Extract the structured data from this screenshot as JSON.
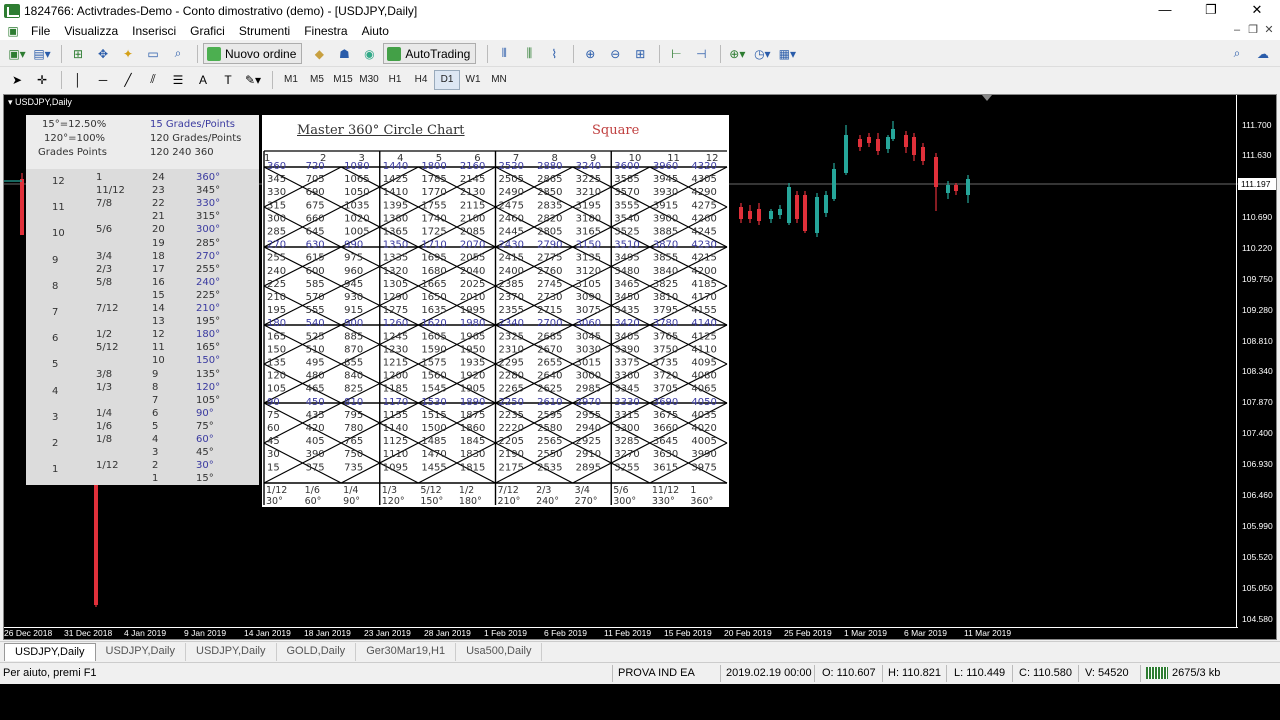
{
  "window": {
    "title": "1824766: Activtrades-Demo - Conto dimostrativo (demo) - [USDJPY,Daily]",
    "minimize": "—",
    "maximize": "❐",
    "close": "✕"
  },
  "menu": [
    "File",
    "Visualizza",
    "Inserisci",
    "Grafici",
    "Strumenti",
    "Finestra",
    "Aiuto"
  ],
  "toolbar": {
    "new_order_label": "Nuovo ordine",
    "autotrading_label": "AutoTrading"
  },
  "timeframes": [
    "M1",
    "M5",
    "M15",
    "M30",
    "H1",
    "H4",
    "D1",
    "W1",
    "MN"
  ],
  "active_timeframe": "D1",
  "chart": {
    "symbol_label": "USDJPY,Daily",
    "current_price": "111.197",
    "price_labels": [
      "111.700",
      "111.630",
      "111.197",
      "110.690",
      "110.220",
      "109.750",
      "109.280",
      "108.810",
      "108.340",
      "107.870",
      "107.400",
      "106.930",
      "106.460",
      "105.990",
      "105.520",
      "105.050",
      "104.580"
    ],
    "time_labels": [
      "26 Dec 2018",
      "31 Dec 2018",
      "4 Jan 2019",
      "9 Jan 2019",
      "14 Jan 2019",
      "18 Jan 2019",
      "23 Jan 2019",
      "28 Jan 2019",
      "1 Feb 2019",
      "6 Feb 2019",
      "11 Feb 2019",
      "15 Feb 2019",
      "20 Feb 2019",
      "25 Feb 2019",
      "1 Mar 2019",
      "6 Mar 2019",
      "11 Mar 2019"
    ],
    "colors": {
      "bull": "#26a69a",
      "bear": "#e0303a",
      "background": "#000000"
    }
  },
  "overlay": {
    "header_lines": [
      "15°=12.50%",
      "120°=100%",
      "Grades Points"
    ],
    "header_right": [
      "15  Grades/Points",
      "120 Grades/Points",
      "120  240  360"
    ],
    "title": "Master 360° Circle Chart",
    "square_label": "Square",
    "col_headers": [
      "1",
      "2",
      "3",
      "4",
      "5",
      "6",
      "7",
      "8",
      "9",
      "10",
      "11",
      "12"
    ],
    "left_rows": [
      [
        "12",
        "1",
        "24",
        "360°"
      ],
      [
        "",
        "11/12",
        "23",
        "345°"
      ],
      [
        "11",
        "7/8",
        "22",
        "330°"
      ],
      [
        "",
        "",
        "21",
        "315°"
      ],
      [
        "10",
        "5/6",
        "20",
        "300°"
      ],
      [
        "",
        "",
        "19",
        "285°"
      ],
      [
        "9",
        "3/4",
        "18",
        "270°"
      ],
      [
        "",
        "2/3",
        "17",
        "255°"
      ],
      [
        "8",
        "5/8",
        "16",
        "240°"
      ],
      [
        "",
        "",
        "15",
        "225°"
      ],
      [
        "7",
        "7/12",
        "14",
        "210°"
      ],
      [
        "",
        "",
        "13",
        "195°"
      ],
      [
        "6",
        "1/2",
        "12",
        "180°"
      ],
      [
        "",
        "5/12",
        "11",
        "165°"
      ],
      [
        "5",
        "",
        "10",
        "150°"
      ],
      [
        "",
        "3/8",
        "9",
        "135°"
      ],
      [
        "4",
        "1/3",
        "8",
        "120°"
      ],
      [
        "",
        "",
        "7",
        "105°"
      ],
      [
        "3",
        "1/4",
        "6",
        "90°"
      ],
      [
        "",
        "1/6",
        "5",
        "75°"
      ],
      [
        "2",
        "1/8",
        "4",
        "60°"
      ],
      [
        "",
        "",
        "3",
        "45°"
      ],
      [
        "1",
        "1/12",
        "2",
        "30°"
      ],
      [
        "",
        "",
        "1",
        "15°"
      ]
    ],
    "footer_fracs": [
      "1/12",
      "1/6",
      "1/4",
      "1/3",
      "5/12",
      "1/2",
      "7/12",
      "2/3",
      "3/4",
      "5/6",
      "11/12",
      "1"
    ],
    "footer_degs": [
      "30°",
      "60°",
      "90°",
      "120°",
      "150°",
      "180°",
      "210°",
      "240°",
      "270°",
      "300°",
      "330°",
      "360°"
    ]
  },
  "tabs": [
    "USDJPY,Daily",
    "USDJPY,Daily",
    "USDJPY,Daily",
    "GOLD,Daily",
    "Ger30Mar19,H1",
    "Usa500,Daily"
  ],
  "status": {
    "help": "Per aiuto, premi F1",
    "profile": "PROVA IND EA",
    "datetime": "2019.02.19 00:00",
    "open": "O: 110.607",
    "high": "H: 110.821",
    "low": "L: 110.449",
    "close": "C: 110.580",
    "volume": "V: 54520",
    "traffic": "2675/3 kb"
  }
}
